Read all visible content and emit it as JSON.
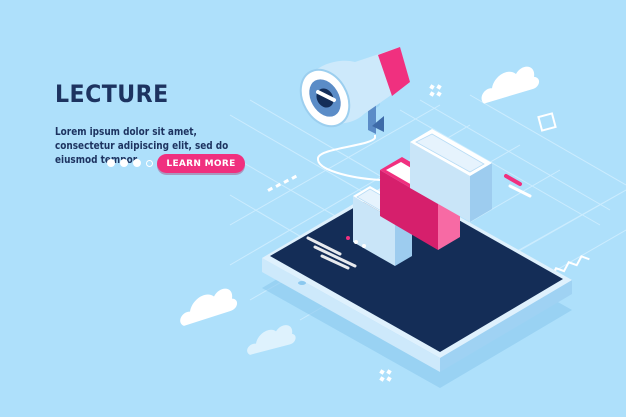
{
  "hero": {
    "title": "LECTURE",
    "description": "Lorem ipsum dolor sit amet, consectetur adipiscing elit, sed do eiusmod tempor",
    "button_label": "LEARN MORE"
  },
  "carousel": {
    "total": 4,
    "active": 4
  },
  "colors": {
    "background": "#aee0fb",
    "title": "#1d3360",
    "accent": "#f0307f",
    "phone_screen": "#142d57",
    "book_white": "#e6f3fd",
    "book_pink": "#f0307f"
  },
  "icons": [
    "megaphone-icon",
    "book-icon",
    "cloud-icon",
    "smartphone-icon"
  ]
}
